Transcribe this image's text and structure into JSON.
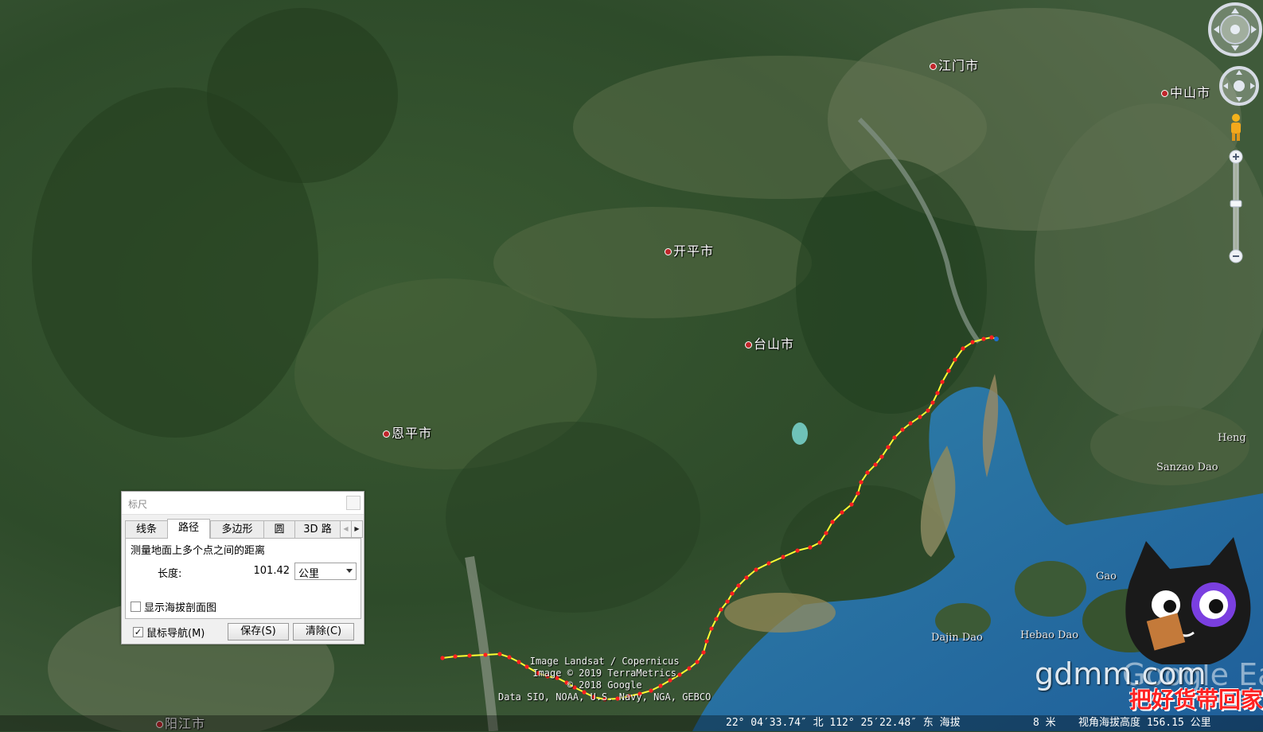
{
  "cities": [
    {
      "name": "江门市"
    },
    {
      "name": "中山市"
    },
    {
      "name": "开平市"
    },
    {
      "name": "台山市"
    },
    {
      "name": "恩平市"
    },
    {
      "name": "阳江市"
    }
  ],
  "islands": [
    "Sanzao Dao",
    "Dajin Dao",
    "Hebao Dao",
    "Heng",
    "Gao"
  ],
  "credits": {
    "line1": "Image Landsat / Copernicus",
    "line2": "Image © 2019 TerraMetrics",
    "line3": "© 2018 Google",
    "line4": "Data SIO, NOAA, U.S. Navy, NGA, GEBCO"
  },
  "status_bar": {
    "coords": "22° 04′33.74″ 北 112° 25′22.48″ 东 海拔",
    "elevation": "8 米",
    "eye_alt": "视角海拔高度 156.15 公里"
  },
  "ruler": {
    "title": "标尺",
    "tabs": [
      "线条",
      "路径",
      "多边形",
      "圆",
      "3D 路"
    ],
    "active_tab": "路径",
    "description": "测量地面上多个点之间的距离",
    "length_label": "长度:",
    "length_value": "101.42",
    "unit": "公里",
    "show_elevation_label": "显示海拔剖面图",
    "show_elevation_checked": false,
    "mouse_nav_label": "鼠标导航(M)",
    "mouse_nav_checked": true,
    "save_label": "保存(S)",
    "clear_label": "清除(C)"
  },
  "watermark": {
    "site": "gdmm.com",
    "ge_logo": "Google Earth",
    "promo": "把好货带回家"
  },
  "colors": {
    "path": "#ffff33",
    "vertex": "#ff2020",
    "accent": "#1c6fd1"
  }
}
